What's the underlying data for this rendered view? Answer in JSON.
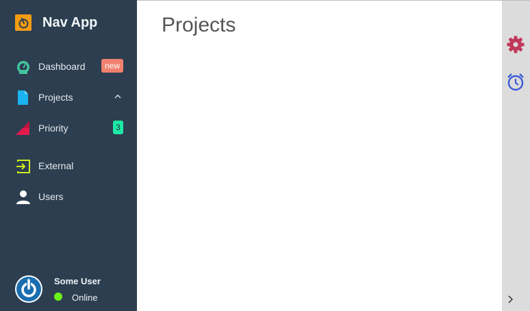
{
  "app": {
    "title": "Nav App",
    "logo_icon": "power-icon",
    "accent": "#f39c12"
  },
  "sidebar": {
    "items": [
      {
        "label": "Dashboard",
        "icon": "speedometer-icon",
        "badge": "new",
        "badge_color": "#f1816f"
      },
      {
        "label": "Projects",
        "icon": "file-icon",
        "expanded": true
      },
      {
        "label": "Priority",
        "icon": "signal-icon",
        "badge": "3",
        "badge_color": "#1de9a6"
      },
      {
        "label": "External",
        "icon": "login-icon"
      },
      {
        "label": "Users",
        "icon": "person-icon"
      }
    ]
  },
  "user": {
    "name": "Some User",
    "status": "Online",
    "status_color": "#6cf01a"
  },
  "main": {
    "title": "Projects"
  },
  "rightbar": {
    "icons": [
      "gear-icon",
      "alarm-clock-icon",
      "chevron-right-icon"
    ]
  }
}
